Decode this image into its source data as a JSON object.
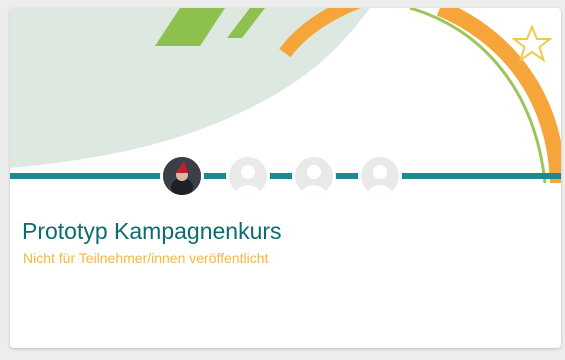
{
  "course": {
    "title": "Prototyp Kampagnenkurs",
    "status": "Nicht für Teilnehmer/innen veröffentlicht"
  },
  "participants": [
    {
      "type": "photo"
    },
    {
      "type": "placeholder"
    },
    {
      "type": "placeholder"
    },
    {
      "type": "placeholder"
    }
  ],
  "icons": {
    "favorite": "star-icon",
    "avatar_placeholder": "person-icon"
  },
  "colors": {
    "title": "#0d6b70",
    "status": "#f6b73c",
    "divider": "#1d8a93",
    "orange_arc": "#f5a53a",
    "green_stripe": "#8dc04f",
    "star_outline": "#f2c94c"
  }
}
